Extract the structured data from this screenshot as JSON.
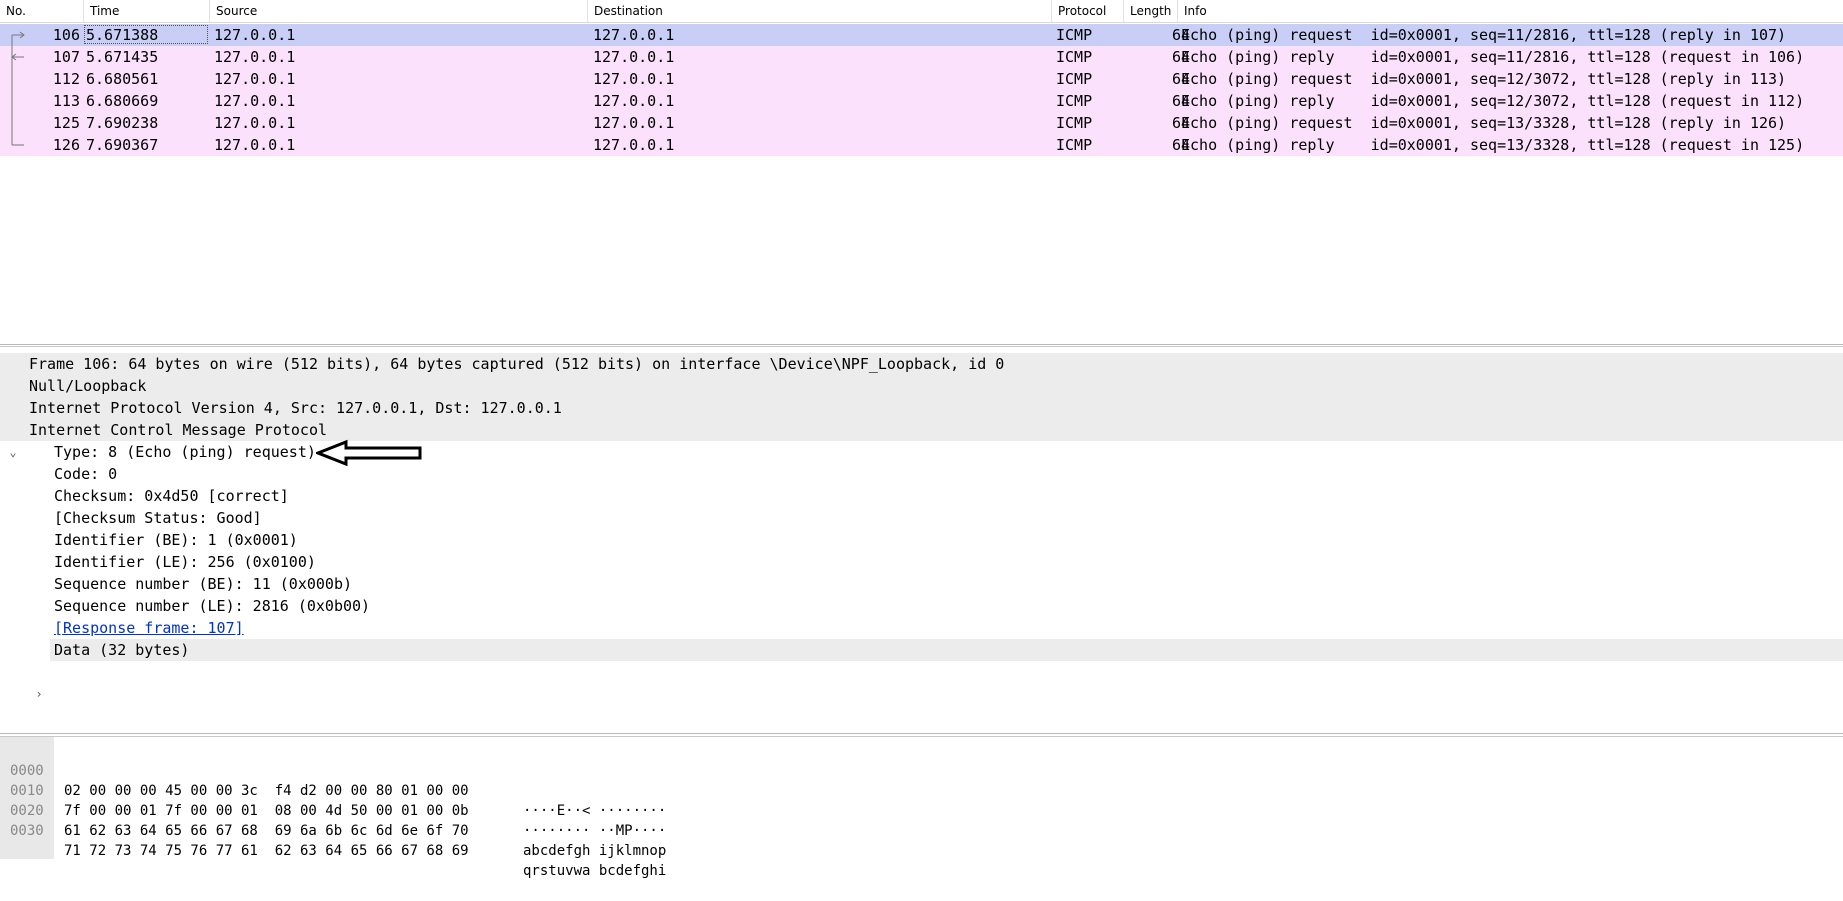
{
  "columns": {
    "no": "No.",
    "time": "Time",
    "source": "Source",
    "destination": "Destination",
    "protocol": "Protocol",
    "length": "Length",
    "info": "Info"
  },
  "packets": [
    {
      "no": "106",
      "time": "5.671388",
      "source": "127.0.0.1",
      "destination": "127.0.0.1",
      "protocol": "ICMP",
      "length": "64",
      "info": "Echo (ping) request  id=0x0001, seq=11/2816, ttl=128 (reply in 107)"
    },
    {
      "no": "107",
      "time": "5.671435",
      "source": "127.0.0.1",
      "destination": "127.0.0.1",
      "protocol": "ICMP",
      "length": "64",
      "info": "Echo (ping) reply    id=0x0001, seq=11/2816, ttl=128 (request in 106)"
    },
    {
      "no": "112",
      "time": "6.680561",
      "source": "127.0.0.1",
      "destination": "127.0.0.1",
      "protocol": "ICMP",
      "length": "64",
      "info": "Echo (ping) request  id=0x0001, seq=12/3072, ttl=128 (reply in 113)"
    },
    {
      "no": "113",
      "time": "6.680669",
      "source": "127.0.0.1",
      "destination": "127.0.0.1",
      "protocol": "ICMP",
      "length": "64",
      "info": "Echo (ping) reply    id=0x0001, seq=12/3072, ttl=128 (request in 112)"
    },
    {
      "no": "125",
      "time": "7.690238",
      "source": "127.0.0.1",
      "destination": "127.0.0.1",
      "protocol": "ICMP",
      "length": "64",
      "info": "Echo (ping) request  id=0x0001, seq=13/3328, ttl=128 (reply in 126)"
    },
    {
      "no": "126",
      "time": "7.690367",
      "source": "127.0.0.1",
      "destination": "127.0.0.1",
      "protocol": "ICMP",
      "length": "64",
      "info": "Echo (ping) reply    id=0x0001, seq=13/3328, ttl=128 (request in 125)"
    }
  ],
  "details": {
    "frame": "Frame 106: 64 bytes on wire (512 bits), 64 bytes captured (512 bits) on interface \\Device\\NPF_Loopback, id 0",
    "null_loopback": "Null/Loopback",
    "ipv4": "Internet Protocol Version 4, Src: 127.0.0.1, Dst: 127.0.0.1",
    "icmp": "Internet Control Message Protocol",
    "type": "Type: 8 (Echo (ping) request)",
    "code": "Code: 0",
    "checksum": "Checksum: 0x4d50 [correct]",
    "checksum_status": "[Checksum Status: Good]",
    "identifier_be": "Identifier (BE): 1 (0x0001)",
    "identifier_le": "Identifier (LE): 256 (0x0100)",
    "sequence_be": "Sequence number (BE): 11 (0x000b)",
    "sequence_le": "Sequence number (LE): 2816 (0x0b00)",
    "response_frame": "[Response frame: 107]",
    "data": "Data (32 bytes)"
  },
  "bytes": [
    {
      "offset": "0000",
      "hex": "02 00 00 00 45 00 00 3c  f4 d2 00 00 80 01 00 00",
      "ascii": "····E··< ········"
    },
    {
      "offset": "0010",
      "hex": "7f 00 00 01 7f 00 00 01  08 00 4d 50 00 01 00 0b",
      "ascii": "········ ··MP····"
    },
    {
      "offset": "0020",
      "hex": "61 62 63 64 65 66 67 68  69 6a 6b 6c 6d 6e 6f 70",
      "ascii": "abcdefgh ijklmnop"
    },
    {
      "offset": "0030",
      "hex": "71 72 73 74 75 76 77 61  62 63 64 65 66 67 68 69",
      "ascii": "qrstuvwa bcdefghi"
    }
  ],
  "colors": {
    "selected_row": "#c8cef6",
    "icmp_row": "#fbe1fb",
    "detail_header_bg": "#ececec"
  }
}
